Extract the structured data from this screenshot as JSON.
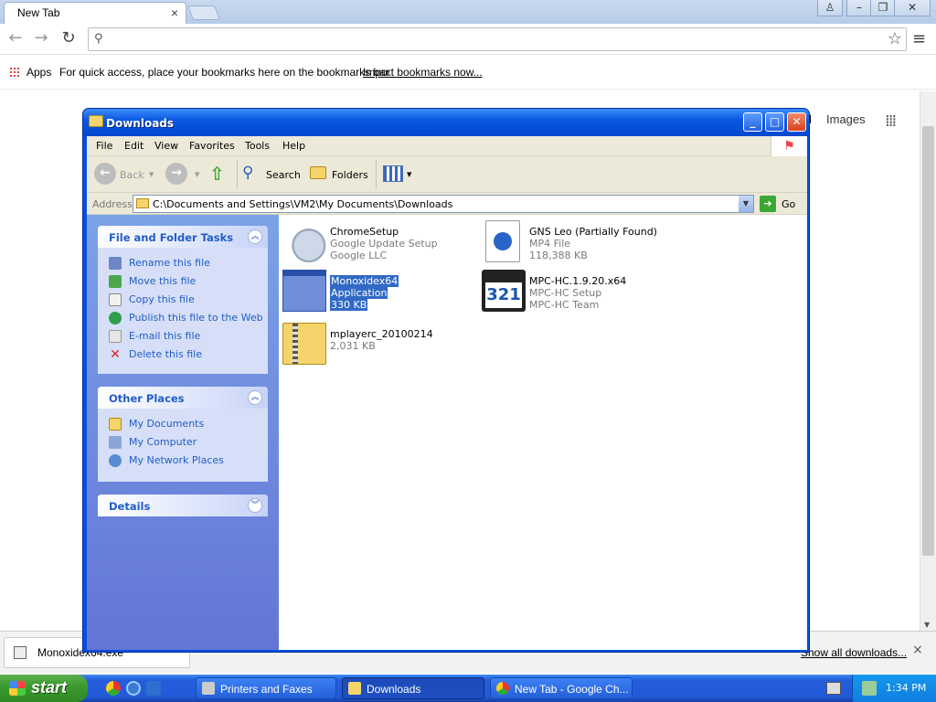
{
  "chrome": {
    "tab_title": "New Tab",
    "tab_close": "×",
    "window_buttons": [
      "–",
      "❐",
      "✕"
    ],
    "omnibox_value": "",
    "bookmarks_apps": "Apps",
    "bookmarks_hint": "For quick access, place your bookmarks here on the bookmarks bar.",
    "bookmarks_import": "Import bookmarks now...",
    "google_link_images": "Images",
    "google_link_partial": "l"
  },
  "downloads_bar": {
    "item_name": "Monoxidex64.exe",
    "show_all": "Show all downloads...",
    "close": "×"
  },
  "explorer": {
    "title": "Downloads",
    "menu": [
      "File",
      "Edit",
      "View",
      "Favorites",
      "Tools",
      "Help"
    ],
    "toolbar": {
      "back": "Back",
      "search": "Search",
      "folders": "Folders"
    },
    "address_label": "Address",
    "address_value": "C:\\Documents and Settings\\VM2\\My Documents\\Downloads",
    "go_label": "Go",
    "panels": {
      "tasks": {
        "title": "File and Folder Tasks",
        "items": [
          "Rename this file",
          "Move this file",
          "Copy this file",
          "Publish this file to the Web",
          "E-mail this file",
          "Delete this file"
        ]
      },
      "places": {
        "title": "Other Places",
        "items": [
          "My Documents",
          "My Computer",
          "My Network Places"
        ]
      },
      "details": {
        "title": "Details"
      }
    },
    "files": [
      {
        "name": "ChromeSetup",
        "line2": "Google Update Setup",
        "line3": "Google LLC"
      },
      {
        "name": "GNS Leo (Partially Found)",
        "line2": "MP4 File",
        "line3": "118,388 KB"
      },
      {
        "name": "Monoxidex64",
        "line2": "Application",
        "line3": "330 KB"
      },
      {
        "name": "MPC-HC.1.9.20.x64",
        "line2": "MPC-HC Setup",
        "line3": "MPC-HC Team"
      },
      {
        "name": "mplayerc_20100214",
        "line2": "2,031 KB",
        "line3": ""
      }
    ]
  },
  "taskbar": {
    "start": "start",
    "tasks": [
      "Printers and Faxes",
      "Downloads",
      "New Tab - Google Ch..."
    ],
    "clock": "1:34 PM"
  }
}
